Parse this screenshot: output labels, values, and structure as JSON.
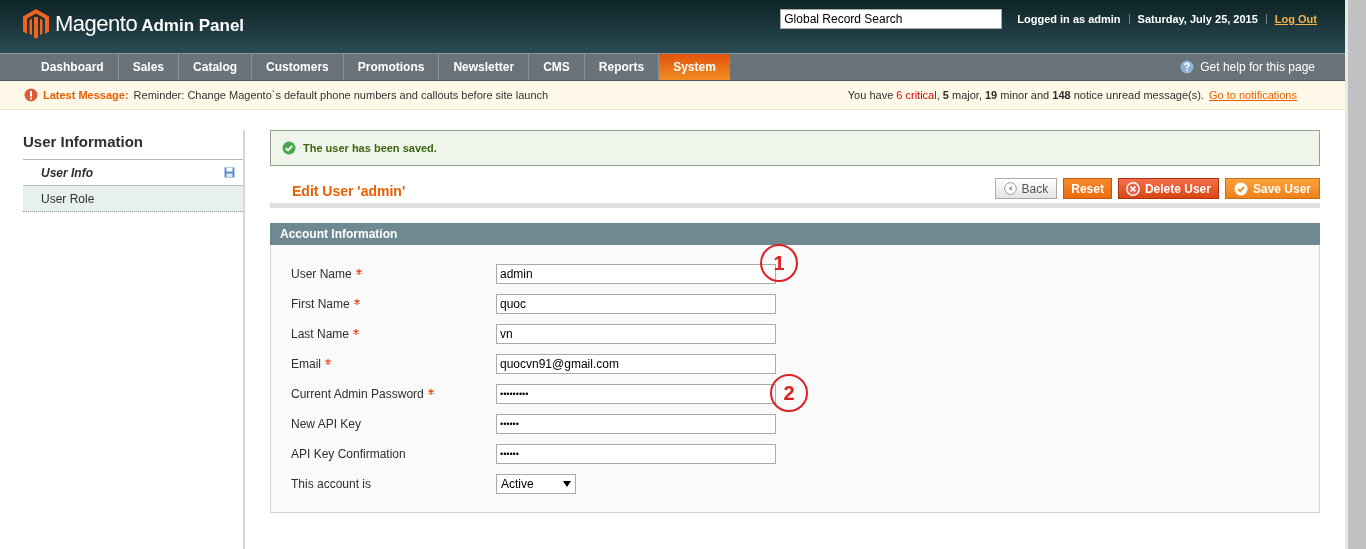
{
  "header": {
    "logo": "Magento",
    "logo_sub": "Admin Panel",
    "search": {
      "value": "Global Record Search"
    },
    "user": "Logged in as admin",
    "date": "Saturday, July 25, 2015",
    "logout": "Log Out"
  },
  "nav": [
    {
      "label": "Dashboard",
      "selected": false
    },
    {
      "label": "Sales",
      "selected": false
    },
    {
      "label": "Catalog",
      "selected": false
    },
    {
      "label": "Customers",
      "selected": false
    },
    {
      "label": "Promotions",
      "selected": false
    },
    {
      "label": "Newsletter",
      "selected": false
    },
    {
      "label": "CMS",
      "selected": false
    },
    {
      "label": "Reports",
      "selected": false
    },
    {
      "label": "System",
      "selected": true
    }
  ],
  "help": "Get help for this page",
  "notice": {
    "title": "Latest Message:",
    "text": "Reminder: Change Magento`s default phone numbers and callouts before site launch",
    "summary": [
      {
        "text": "You have ",
        "kind": "plain"
      },
      {
        "text": "6 critical",
        "kind": "critical"
      },
      {
        "text": ", ",
        "kind": "plain"
      },
      {
        "text": "5",
        "kind": "bold"
      },
      {
        "text": " major, ",
        "kind": "plain"
      },
      {
        "text": "19",
        "kind": "bold"
      },
      {
        "text": " minor and ",
        "kind": "plain"
      },
      {
        "text": "148",
        "kind": "bold"
      },
      {
        "text": " notice unread message(s).",
        "kind": "plain"
      }
    ],
    "link": "Go to notifications"
  },
  "sidebar": {
    "title": "User Information",
    "items": [
      {
        "label": "User Info",
        "selected": true
      },
      {
        "label": "User Role",
        "selected": false
      }
    ]
  },
  "success": "The user has been saved.",
  "page_title": "Edit User 'admin'",
  "buttons": [
    {
      "label": "Back",
      "kind": "back"
    },
    {
      "label": "Reset",
      "kind": "reset"
    },
    {
      "label": "Delete User",
      "kind": "delete"
    },
    {
      "label": "Save User",
      "kind": "save"
    }
  ],
  "section": {
    "title": "Account Information",
    "fields": [
      {
        "label": "User Name",
        "required": true,
        "kind": "text",
        "value": "admin",
        "marker": "1"
      },
      {
        "label": "First Name",
        "required": true,
        "kind": "text",
        "value": "quoc"
      },
      {
        "label": "Last Name",
        "required": true,
        "kind": "text",
        "value": "vn"
      },
      {
        "label": "Email",
        "required": true,
        "kind": "text",
        "value": "quocvn91@gmail.com"
      },
      {
        "label": "Current Admin Password",
        "required": true,
        "kind": "password",
        "value": "•••••••••",
        "marker": "2"
      },
      {
        "label": "New API Key",
        "required": false,
        "kind": "password",
        "value": "••••••"
      },
      {
        "label": "API Key Confirmation",
        "required": false,
        "kind": "password",
        "value": "••••••"
      },
      {
        "label": "This account is",
        "required": false,
        "kind": "select",
        "value": "Active"
      }
    ]
  }
}
